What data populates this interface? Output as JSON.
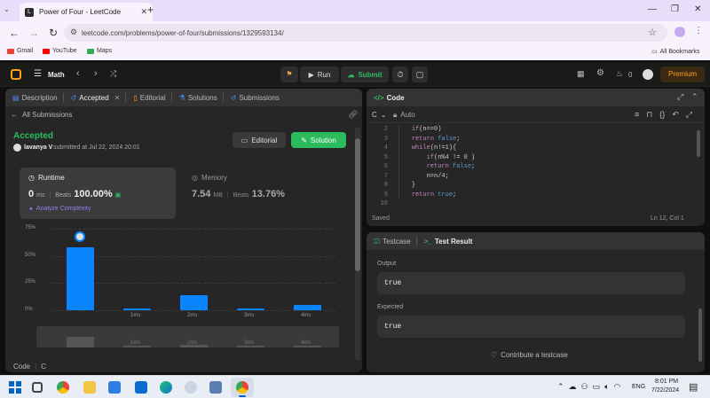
{
  "browser": {
    "tab_title": "Power of Four - LeetCode",
    "tab_favicon": "L",
    "url": "leetcode.com/problems/power-of-four/submissions/1329593134/",
    "bookmarks": [
      "Gmail",
      "YouTube",
      "Maps"
    ],
    "all_bookmarks": "All Bookmarks"
  },
  "lc": {
    "brand": "Math",
    "run": "Run",
    "submit": "Submit",
    "fire_count": "0",
    "premium": "Premium"
  },
  "left": {
    "tabs": [
      "Description",
      "Accepted",
      "Editorial",
      "Solutions",
      "Submissions"
    ],
    "all_submissions": "All Submissions",
    "status": "Accepted",
    "user": "lavanya V",
    "submitted": "submitted at Jul 22, 2024 20:01",
    "editorial_btn": "Editorial",
    "solution_btn": "Solution",
    "runtime_label": "Runtime",
    "runtime_value": "0",
    "runtime_unit": "ms",
    "beats_label": "Beats",
    "runtime_beats": "100.00%",
    "analyze": "Analyze Complexity",
    "memory_label": "Memory",
    "memory_value": "7.54",
    "memory_unit": "MB",
    "memory_beats": "13.76%",
    "code_label": "Code",
    "lang_label": "C"
  },
  "chart_data": {
    "type": "bar",
    "categories": [
      "",
      "1ms",
      "2ms",
      "3ms",
      "4ms"
    ],
    "values": [
      58,
      2,
      14,
      2,
      5
    ],
    "ylim": [
      0,
      75
    ],
    "yticks": [
      "75%",
      "50%",
      "25%",
      "0%"
    ],
    "mini_labels": [
      "1ms",
      "2ms",
      "3ms",
      "4ms"
    ],
    "color": "#0a84ff"
  },
  "code": {
    "title": "Code",
    "lang": "C",
    "mode": "Auto",
    "lines": [
      {
        "n": "2",
        "t": "    if(n==0)"
      },
      {
        "n": "3",
        "t": "    return false;"
      },
      {
        "n": "4",
        "t": "    while(n!=1){"
      },
      {
        "n": "5",
        "t": "        if(n%4 != 0 )"
      },
      {
        "n": "6",
        "t": "        return false;"
      },
      {
        "n": "7",
        "t": "        n=n/4;"
      },
      {
        "n": "8",
        "t": "    }"
      },
      {
        "n": "9",
        "t": "    return true;"
      },
      {
        "n": "10",
        "t": ""
      }
    ],
    "saved": "Saved",
    "cursor": "Ln 12, Col 1"
  },
  "result": {
    "testcase_tab": "Testcase",
    "result_tab": "Test Result",
    "output_label": "Output",
    "output_value": "true",
    "expected_label": "Expected",
    "expected_value": "true",
    "contribute": "Contribute a testcase"
  },
  "taskbar": {
    "lang": "ENG",
    "time": "8:01 PM",
    "date": "7/22/2024"
  }
}
